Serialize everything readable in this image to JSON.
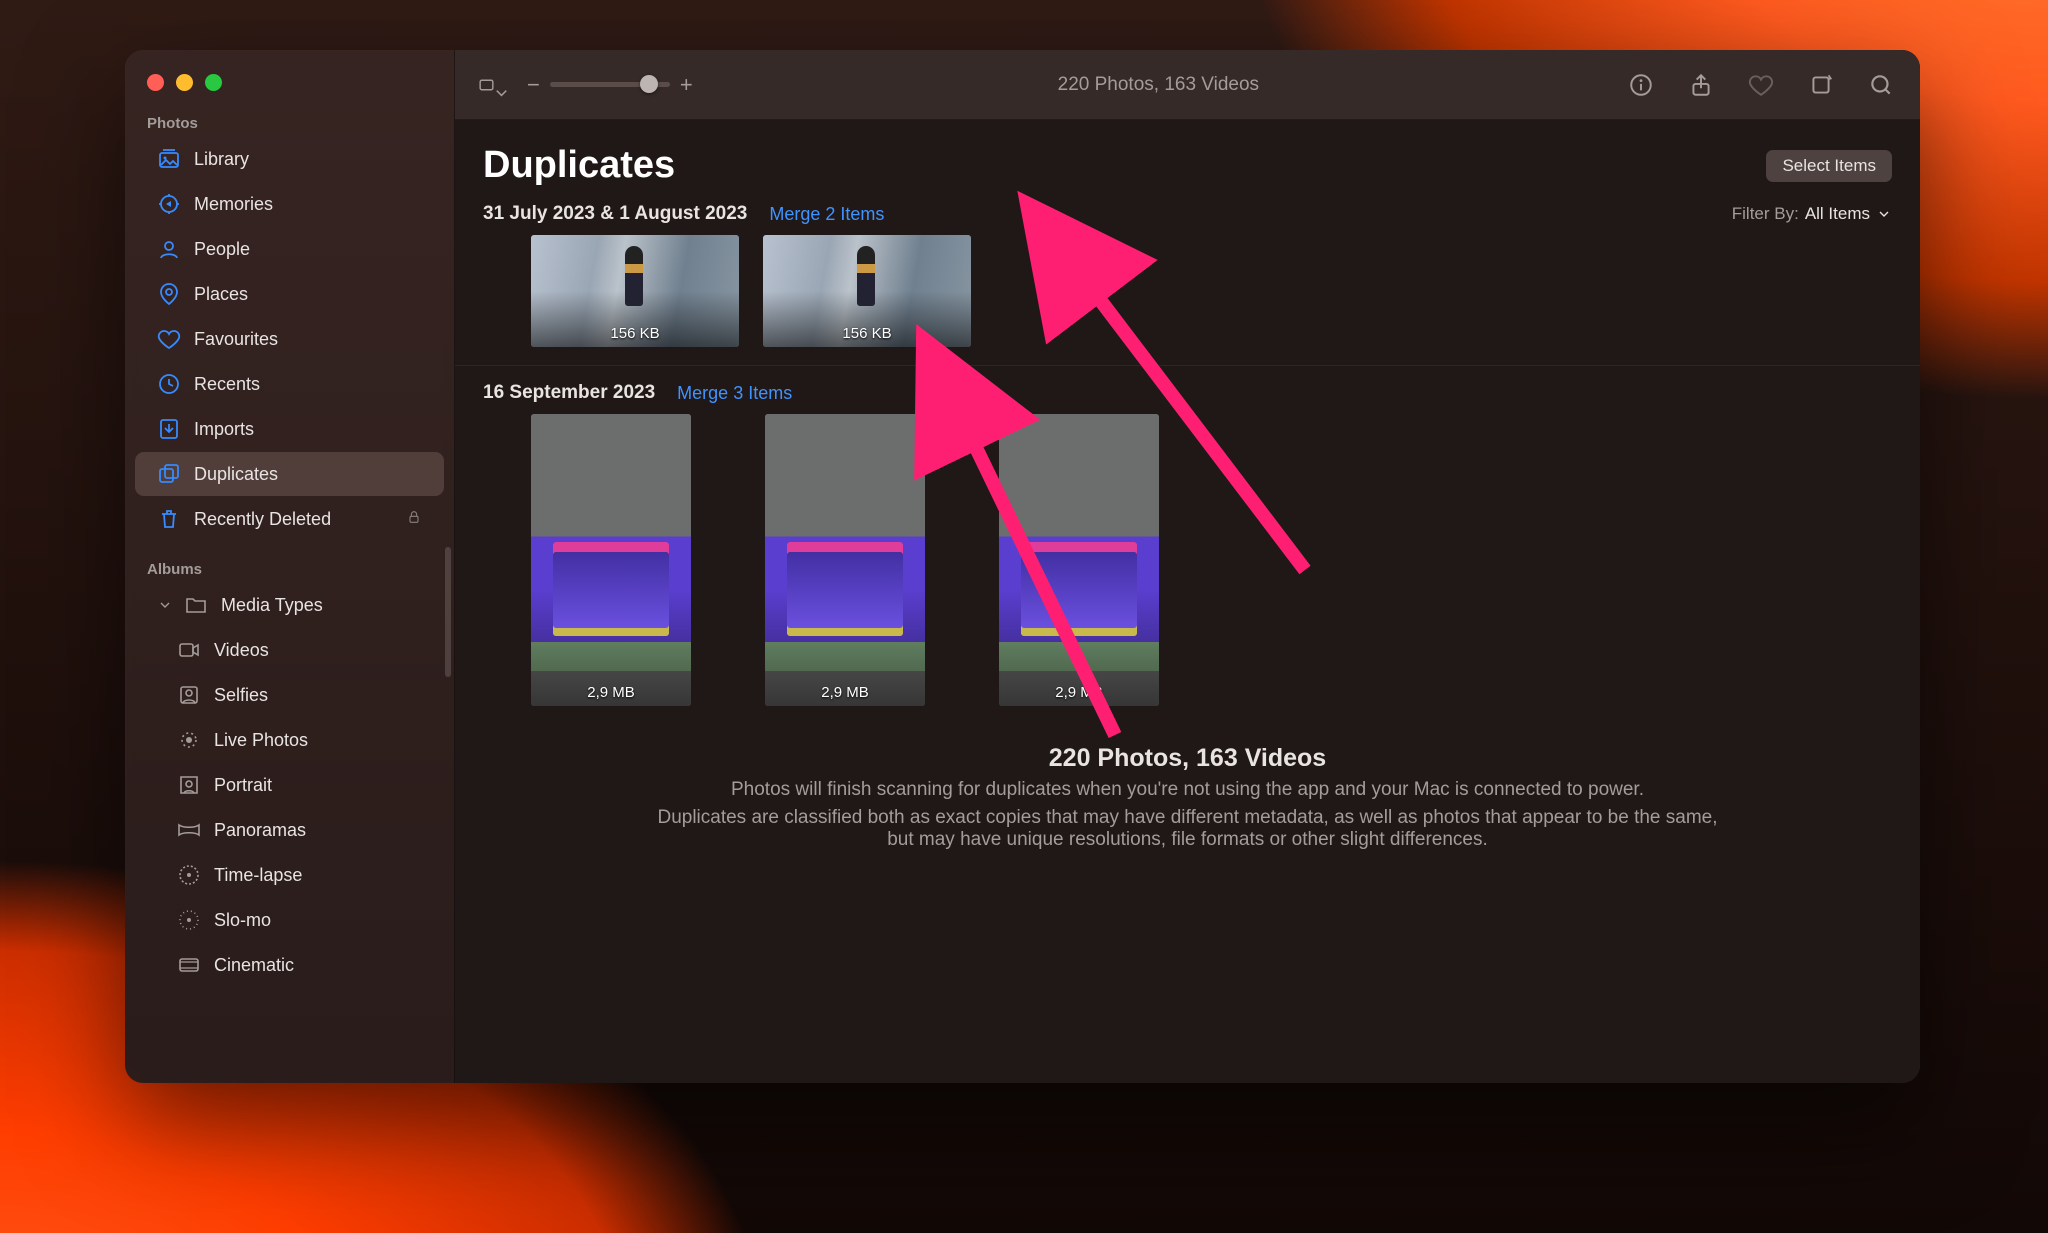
{
  "sidebar": {
    "section_photos": "Photos",
    "section_albums": "Albums",
    "items": [
      {
        "icon": "library",
        "label": "Library"
      },
      {
        "icon": "memories",
        "label": "Memories"
      },
      {
        "icon": "people",
        "label": "People"
      },
      {
        "icon": "places",
        "label": "Places"
      },
      {
        "icon": "favourites",
        "label": "Favourites"
      },
      {
        "icon": "recents",
        "label": "Recents"
      },
      {
        "icon": "imports",
        "label": "Imports"
      },
      {
        "icon": "duplicates",
        "label": "Duplicates"
      },
      {
        "icon": "trash",
        "label": "Recently Deleted"
      }
    ],
    "media_types_label": "Media Types",
    "media_types": [
      {
        "icon": "video",
        "label": "Videos"
      },
      {
        "icon": "selfie",
        "label": "Selfies"
      },
      {
        "icon": "live",
        "label": "Live Photos"
      },
      {
        "icon": "portrait",
        "label": "Portrait"
      },
      {
        "icon": "panorama",
        "label": "Panoramas"
      },
      {
        "icon": "timelapse",
        "label": "Time-lapse"
      },
      {
        "icon": "slomo",
        "label": "Slo-mo"
      },
      {
        "icon": "cinematic",
        "label": "Cinematic"
      }
    ]
  },
  "toolbar": {
    "title": "220 Photos, 163 Videos",
    "zoom_pct": 75
  },
  "page": {
    "title": "Duplicates",
    "select_items": "Select Items",
    "filter_label": "Filter By:",
    "filter_value": "All Items"
  },
  "groups": [
    {
      "date": "31 July 2023 & 1 August 2023",
      "merge": "Merge 2 Items",
      "thumbs": [
        {
          "size": "156 KB"
        },
        {
          "size": "156 KB"
        }
      ]
    },
    {
      "date": "16 September 2023",
      "merge": "Merge 3 Items",
      "thumbs": [
        {
          "size": "2,9 MB"
        },
        {
          "size": "2,9 MB"
        },
        {
          "size": "2,9 MB"
        }
      ]
    }
  ],
  "summary": {
    "heading": "220 Photos, 163 Videos",
    "line1": "Photos will finish scanning for duplicates when you're not using the app and your Mac is connected to power.",
    "line2": "Duplicates are classified both as exact copies that may have different metadata, as well as photos that appear to be the same, but may have unique resolutions, file formats or other slight differences."
  }
}
